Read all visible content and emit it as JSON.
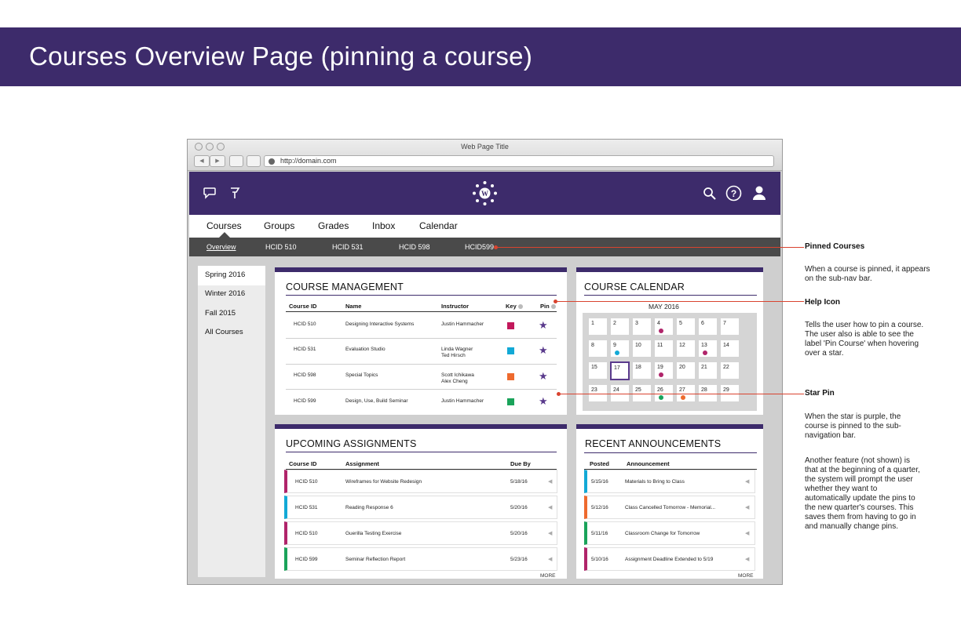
{
  "banner": {
    "title": "Courses Overview Page (pinning a course)"
  },
  "browser": {
    "window_title": "Web Page Title",
    "url": "http://domain.com"
  },
  "main_nav": [
    "Courses",
    "Groups",
    "Grades",
    "Inbox",
    "Calendar"
  ],
  "sub_nav": [
    "Overview",
    "HCID 510",
    "HCID 531",
    "HCID 598",
    "HCID599"
  ],
  "sidebar": {
    "terms": [
      "Spring 2016",
      "Winter 2016",
      "Fall 2015",
      "All Courses"
    ]
  },
  "course_management": {
    "title": "COURSE MANAGEMENT",
    "headers": {
      "id": "Course ID",
      "name": "Name",
      "instructor": "Instructor",
      "key": "Key",
      "pin": "Pin"
    },
    "rows": [
      {
        "id": "HCID 510",
        "name": "Designing Interactive Systems",
        "instructor": "Justin Hammacher",
        "instructor2": "",
        "key_color": "#c2185b"
      },
      {
        "id": "HCID 531",
        "name": "Evaluation Studio",
        "instructor": "Linda Wagner",
        "instructor2": "Ted Hirsch",
        "key_color": "#12a9d6"
      },
      {
        "id": "HCID 598",
        "name": "Special Topics",
        "instructor": "Scott Ichikawa",
        "instructor2": "Alex Cheng",
        "key_color": "#ee6a2e"
      },
      {
        "id": "HCID 599",
        "name": "Design, Use, Build Seminar",
        "instructor": "Justin Hammacher",
        "instructor2": "",
        "key_color": "#1aa35a"
      }
    ],
    "pin_color": "#5a3a8c"
  },
  "calendar": {
    "title": "COURSE CALENDAR",
    "month": "MAY 2016",
    "days": [
      "1",
      "2",
      "3",
      "4",
      "5",
      "6",
      "7",
      "8",
      "9",
      "10",
      "11",
      "12",
      "13",
      "14",
      "15",
      "17",
      "18",
      "19",
      "20",
      "21",
      "22",
      "23",
      "24",
      "25",
      "26",
      "27",
      "28",
      "29"
    ]
  },
  "assignments": {
    "title": "UPCOMING ASSIGNMENTS",
    "headers": {
      "id": "Course ID",
      "assignment": "Assignment",
      "due": "Due By"
    },
    "rows": [
      {
        "id": "HCID 510",
        "assignment": "Wireframes for Website Redesign",
        "due": "5/18/16",
        "color": "#b0246a"
      },
      {
        "id": "HCID 531",
        "assignment": "Reading Response 6",
        "due": "5/20/16",
        "color": "#12a9d6"
      },
      {
        "id": "HCID 510",
        "assignment": "Guerilla Testing Exercise",
        "due": "5/20/16",
        "color": "#b0246a"
      },
      {
        "id": "HCID 599",
        "assignment": "Seminar Reflection Report",
        "due": "5/23/16",
        "color": "#1aa35a"
      }
    ],
    "more": "MORE"
  },
  "announcements": {
    "title": "RECENT ANNOUNCEMENTS",
    "headers": {
      "posted": "Posted",
      "announcement": "Announcement"
    },
    "rows": [
      {
        "posted": "5/15/16",
        "text": "Materials to Bring to Class",
        "color": "#12a9d6"
      },
      {
        "posted": "5/12/16",
        "text": "Class Cancelled Tomorrow - Memorial...",
        "color": "#ee6a2e"
      },
      {
        "posted": "5/11/16",
        "text": "Classroom Change for Tomorrow",
        "color": "#1aa35a"
      },
      {
        "posted": "5/10/16",
        "text": "Assignment Deadline Extended to 5/19",
        "color": "#b0246a"
      }
    ],
    "more": "MORE"
  },
  "callouts": {
    "pinned": {
      "title": "Pinned Courses",
      "text": "When a course is pinned, it appears on the sub-nav bar."
    },
    "help": {
      "title": "Help Icon",
      "text": "Tells the user how to pin a course. The user also is able to see the label 'Pin Course' when hovering over a star."
    },
    "star": {
      "title": "Star Pin",
      "text": "When the star is purple, the course is pinned to the sub-navigation bar.",
      "text2": "Another feature (not shown) is that at the beginning of a quarter, the system will prompt the user whether they want to automatically update the pins to the new quarter's courses. This saves them from having to go in and manually change pins."
    }
  },
  "colors": {
    "brand_purple": "#3d2b6b",
    "callout_red": "#d9432f"
  }
}
